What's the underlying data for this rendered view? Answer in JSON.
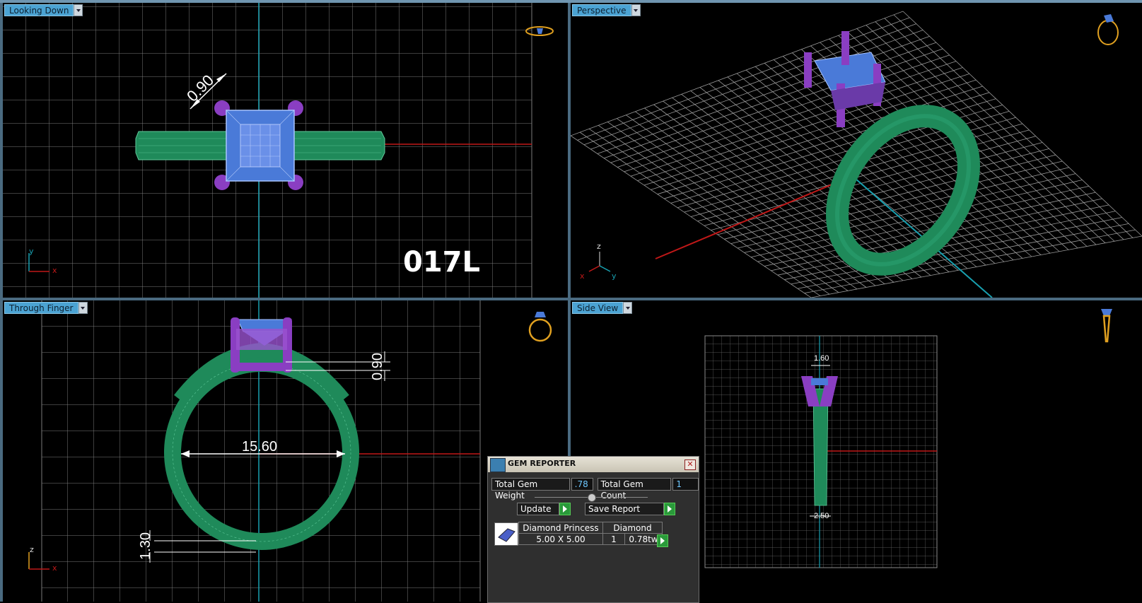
{
  "viewports": {
    "top_left": {
      "label": "Looking Down",
      "design_id": "017L",
      "dimension": "0.90",
      "axis_a": "y",
      "axis_b": "x"
    },
    "top_right": {
      "label": "Perspective",
      "axis_a": "z",
      "axis_b": "x",
      "axis_c": "y"
    },
    "bottom_left": {
      "label": "Through Finger",
      "dim_inner": "15.60",
      "dim_top": "0.90",
      "dim_bottom": "1.30",
      "axis_a": "z",
      "axis_b": "x"
    },
    "bottom_right": {
      "label": "Side View",
      "dim_top": "1.60",
      "dim_bottom": "2.50"
    }
  },
  "gem_reporter": {
    "title": "GEM REPORTER",
    "close": "✕",
    "total_weight_label": "Total Gem Weight",
    "total_weight_value": ".78",
    "total_count_label": "Total Gem Count",
    "total_count_value": "1",
    "update_label": "Update",
    "save_label": "Save Report",
    "table": {
      "header": [
        "Diamond Princess",
        "Diamond"
      ],
      "size": "5.00 X 5.00",
      "count": "1",
      "weight": "0.78tw"
    }
  },
  "colors": {
    "band": "#1f8a5a",
    "prongs": "#8a3ec2",
    "stone": "#4a7ad8",
    "grid": "#8a8a8a",
    "x_axis": "#c01818",
    "y_axis": "#18a0b0",
    "viewport_label_bg": "#4ba3d3"
  }
}
